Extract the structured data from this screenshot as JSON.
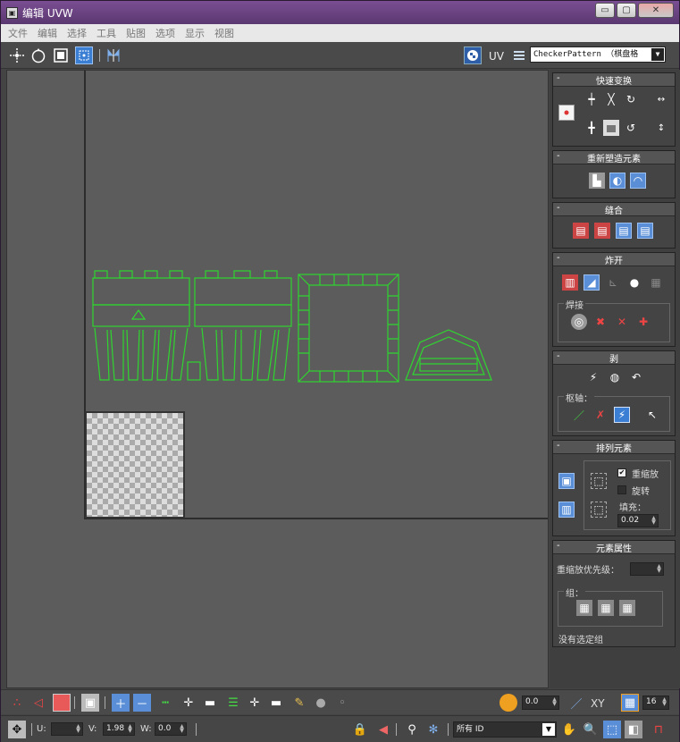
{
  "window": {
    "title": "编辑 UVW",
    "app_icon": "▣",
    "minimize": "▭",
    "maximize": "▢",
    "close": "✕"
  },
  "menu": [
    "文件",
    "编辑",
    "选择",
    "工具",
    "贴图",
    "选项",
    "显示",
    "视图"
  ],
  "toolbar": {
    "uv_label": "UV",
    "texture_select": "CheckerPattern  （棋盘格"
  },
  "panel": {
    "quick_transform": {
      "title": "快速变换"
    },
    "reshape": {
      "title": "重新塑造元素"
    },
    "stitch": {
      "title": "缝合"
    },
    "explode": {
      "title": "炸开",
      "weld_label": "焊接"
    },
    "peel": {
      "title": "剥",
      "pin_label": "枢轴："
    },
    "arrange": {
      "title": "排列元素",
      "rescale_label": "重缩放",
      "rotate_label": "旋转",
      "padding_label": "填充：",
      "padding_value": "0.02"
    },
    "element_props": {
      "title": "元素属性",
      "rescale_priority_label": "重缩放优先级：",
      "group_label": "组：",
      "no_group_text": "没有选定组"
    }
  },
  "bottom": {
    "spinner1_value": "0.0",
    "xy_label": "XY",
    "grid_value": "16",
    "u_label": "U:",
    "u_value": "",
    "v_label": "V:",
    "v_value": "1.98",
    "w_label": "W:",
    "w_value": "0.0",
    "filter_select": "所有 ID"
  },
  "colors": {
    "uv_wire": "#2fd62f",
    "accent": "#3b7fd4",
    "background": "#5c5c5c"
  }
}
